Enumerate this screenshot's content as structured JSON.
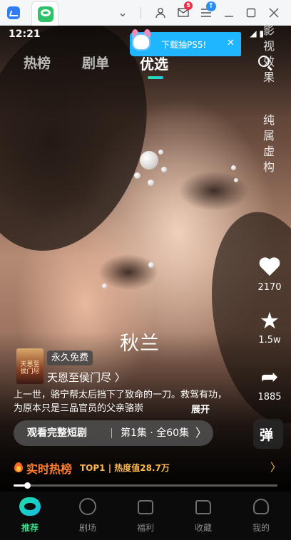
{
  "titlebar": {
    "badge_count": "5",
    "update_symbol": "↑",
    "icons": [
      "app-logo-icon",
      "tab-app-icon",
      "chevron-down-icon",
      "user-icon",
      "mail-icon",
      "menu-icon",
      "minimize-icon",
      "maximize-icon",
      "close-icon"
    ]
  },
  "status": {
    "time": "12:21",
    "right": "◢ ▮"
  },
  "toast": {
    "text": "下载抽PS5!",
    "close": "✕"
  },
  "top_tabs": [
    {
      "label": "热榜",
      "active": false
    },
    {
      "label": "剧单",
      "active": false
    },
    {
      "label": "优选",
      "active": true
    }
  ],
  "watermark": {
    "top": "影视效果",
    "bottom": "纯属虚构"
  },
  "actions": {
    "like_count": "2170",
    "favorite_count": "1.5w",
    "share_count": "1885",
    "danmu_label": "弹"
  },
  "drama": {
    "character_name": "秋兰",
    "poster_title": "天恩至侯门尽",
    "free_badge": "永久免费",
    "series_name": "天恩至侯门尽 〉",
    "description": "上一世，骆宁帮太后挡下了致命的一刀。救驾有功，为原本只是三品官员的父亲骆崇",
    "expand_label": "展开"
  },
  "watch": {
    "label": "观看完整短剧",
    "episode": "第1集 · 全60集",
    "arrow": "〉"
  },
  "hot": {
    "title": "实时热榜",
    "rank": "TOP1 | 热度值28.7万",
    "arrow": "〉"
  },
  "progress": {
    "value": 0.05
  },
  "nav": [
    {
      "label": "推荐",
      "active": true
    },
    {
      "label": "剧场",
      "active": false
    },
    {
      "label": "福利",
      "active": false
    },
    {
      "label": "收藏",
      "active": false
    },
    {
      "label": "我的",
      "active": false
    }
  ],
  "colors": {
    "accent": "#39d98a",
    "toast_bg": "#1fb6ff",
    "hot_title": "#ff7f2e",
    "hot_rank": "#ffb84a"
  }
}
